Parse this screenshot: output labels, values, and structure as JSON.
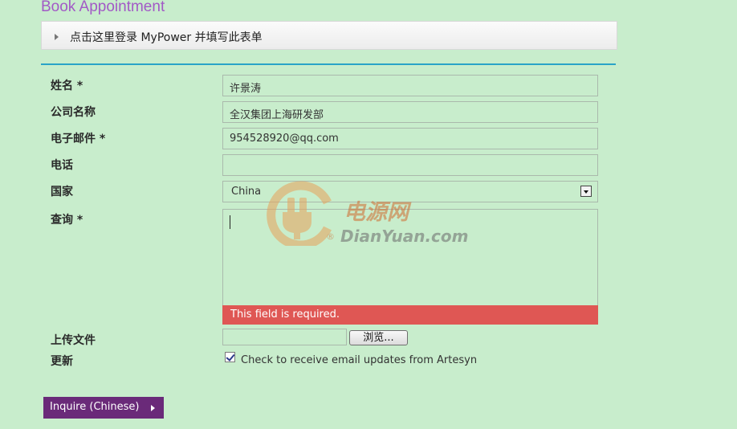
{
  "page": {
    "title": "Book Appointment"
  },
  "login_bar": {
    "label": "点击这里登录 MyPower 并填写此表单"
  },
  "form": {
    "name": {
      "label": "姓名 *",
      "value": "许景涛"
    },
    "company": {
      "label": "公司名称",
      "value": "全汉集团上海研发部"
    },
    "email": {
      "label": "电子邮件 *",
      "value": "954528920@qq.com"
    },
    "phone": {
      "label": "电话",
      "value": ""
    },
    "country": {
      "label": "国家",
      "selected": "China"
    },
    "inquiry": {
      "label": "查询 *",
      "value": "",
      "error": "This field is required."
    },
    "upload": {
      "label": "上传文件",
      "browse_label": "浏览..."
    },
    "updates": {
      "label": "更新",
      "checked": true,
      "checkbox_label": "Check to receive email updates from Artesyn"
    },
    "submit_label": "Inquire (Chinese)"
  },
  "watermark": {
    "cn": "电源网",
    "en": "DianYuan.com",
    "mark": "®"
  },
  "colors": {
    "background": "#c8edcc",
    "title": "#a25ac6",
    "divider": "#2aa3c7",
    "error": "#df5754",
    "submit": "#6a2a79"
  }
}
